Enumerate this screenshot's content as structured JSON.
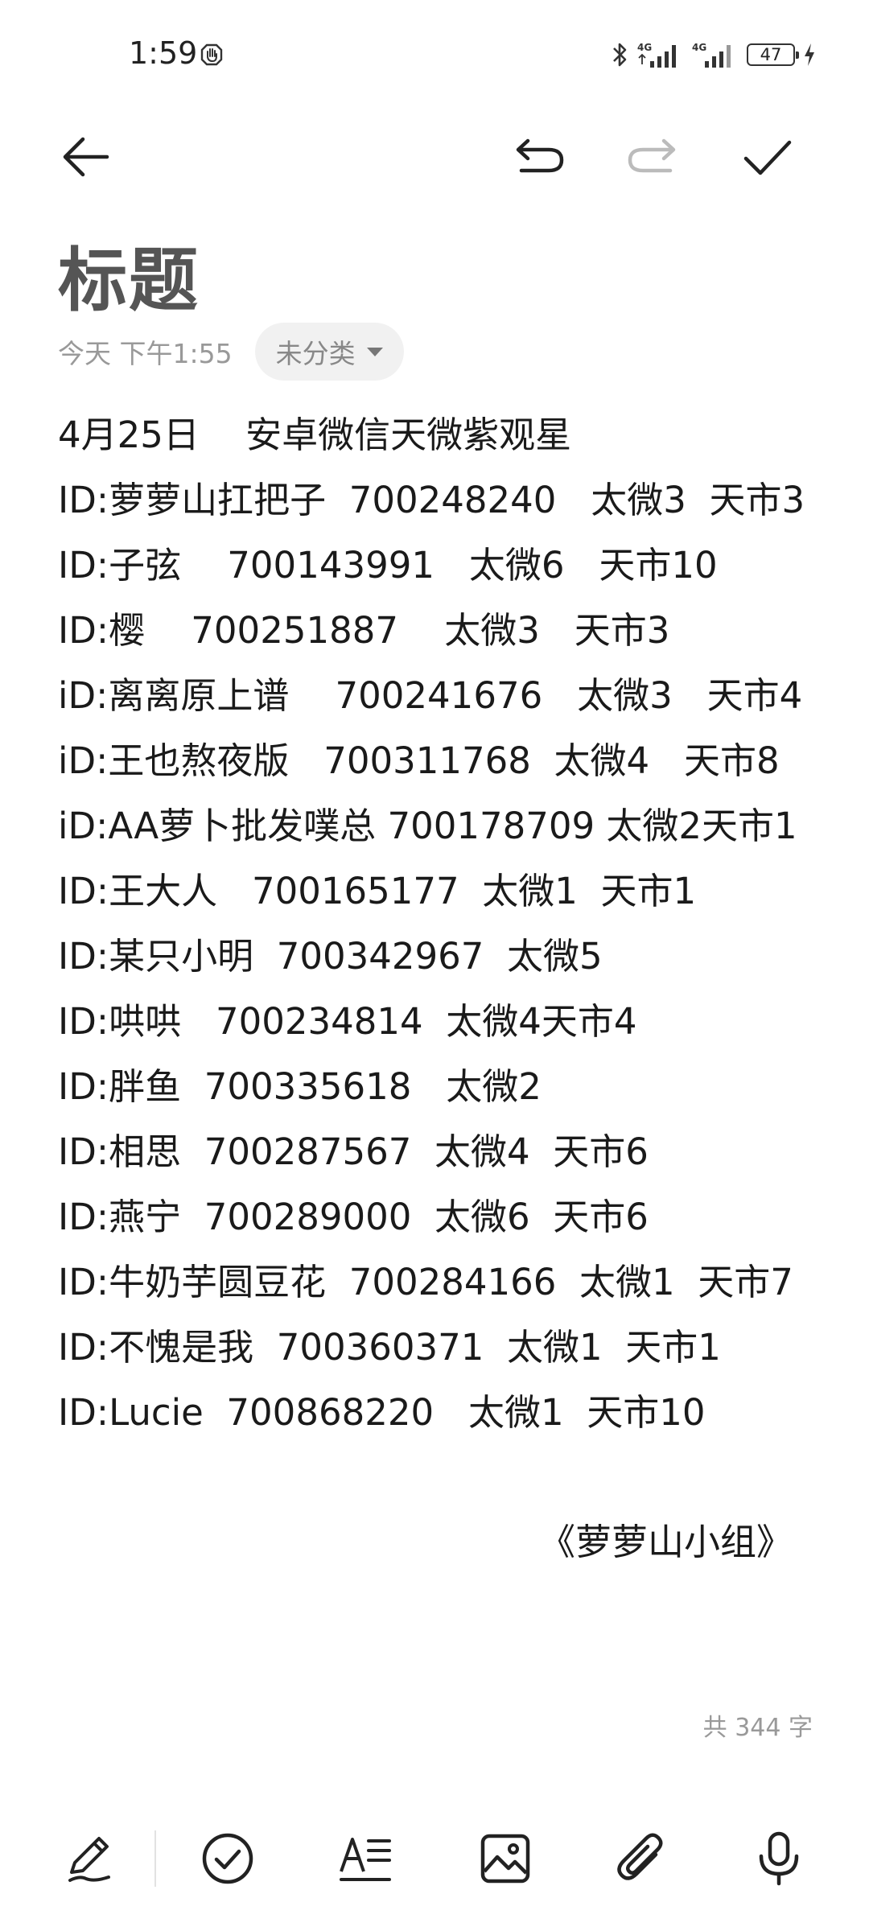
{
  "status_bar": {
    "time": "1:59",
    "battery_level": "47",
    "icons": [
      "hand-icon",
      "bluetooth-icon",
      "signal-4g-icon",
      "signal-4g-icon",
      "battery-icon",
      "charging-icon"
    ]
  },
  "toolbar": {
    "back": "back-arrow-icon",
    "undo": "undo-icon",
    "redo": "redo-icon",
    "confirm": "checkmark-icon"
  },
  "note": {
    "title": "标题",
    "date": "今天 下午1:55",
    "category": "未分类",
    "lines": [
      "4月25日    安卓微信天微紫观星",
      "ID:萝萝山扛把子  700248240   太微3  天市3",
      "ID:子弦    700143991   太微6   天市10",
      "ID:樱    700251887    太微3   天市3",
      "iD:离离原上谱    700241676   太微3   天市4",
      "iD:王也熬夜版   700311768  太微4   天市8",
      "iD:AA萝卜批发噗总 700178709 太微2天市1",
      "ID:王大人   700165177  太微1  天市1",
      "ID:某只小明  700342967  太微5",
      "ID:哄哄   700234814  太微4天市4",
      "ID:胖鱼  700335618   太微2",
      "ID:相思  700287567  太微4  天市6",
      "ID:燕宁  700289000  太微6  天市6",
      "ID:牛奶芋圆豆花  700284166  太微1  天市7",
      "ID:不愧是我  700360371  太微1  天市1",
      "ID:Lucie  700868220   太微1  天市10"
    ],
    "signature": "《萝萝山小组》",
    "word_count": "共 344 字"
  },
  "bottom_toolbar": {
    "items": [
      "pen-icon",
      "checklist-icon",
      "text-format-icon",
      "image-icon",
      "attachment-icon",
      "microphone-icon"
    ]
  },
  "colors": {
    "title": "#555555",
    "text": "#1a1a1a",
    "meta": "#999999",
    "pill_bg": "#f1f1f1",
    "redo_disabled": "#bbbbbb"
  }
}
